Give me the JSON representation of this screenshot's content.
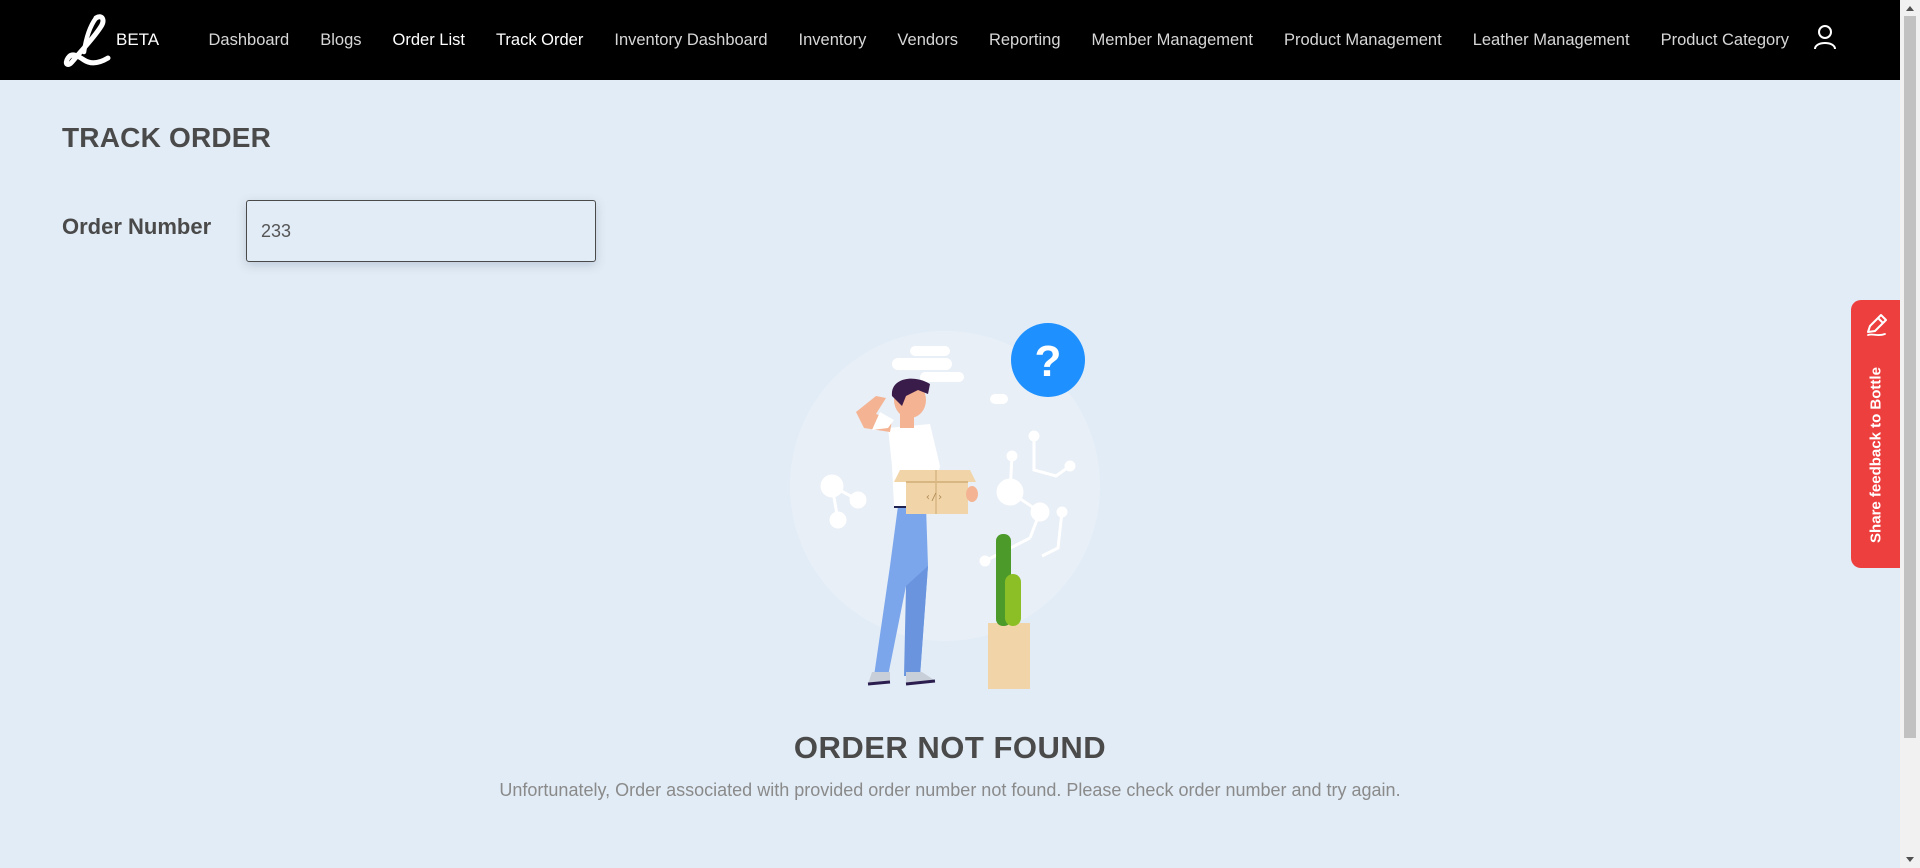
{
  "brand": {
    "logo_letter": "L",
    "badge": "BETA"
  },
  "nav": {
    "items": [
      {
        "label": "Dashboard"
      },
      {
        "label": "Blogs"
      },
      {
        "label": "Order List"
      },
      {
        "label": "Track Order"
      },
      {
        "label": "Inventory Dashboard"
      },
      {
        "label": "Inventory"
      },
      {
        "label": "Vendors"
      },
      {
        "label": "Reporting"
      },
      {
        "label": "Member Management"
      },
      {
        "label": "Product Management"
      },
      {
        "label": "Leather Management"
      },
      {
        "label": "Product Category"
      }
    ],
    "user_icon": "user-icon"
  },
  "page": {
    "title": "TRACK ORDER",
    "order_label": "Order Number",
    "order_value": "233"
  },
  "result": {
    "title": "ORDER NOT FOUND",
    "message": "Unfortunately, Order associated with provided order number not found. Please check order number and try again.",
    "illustration_icon": "confused-person-with-box-illustration",
    "question_mark": "?"
  },
  "feedback": {
    "label": "Share feedback to Bottle",
    "icon": "pencil-icon",
    "color": "#ee3f3f"
  },
  "colors": {
    "background": "#e2ecf6",
    "navbar": "#000000",
    "accent_blue": "#1e90ff"
  }
}
